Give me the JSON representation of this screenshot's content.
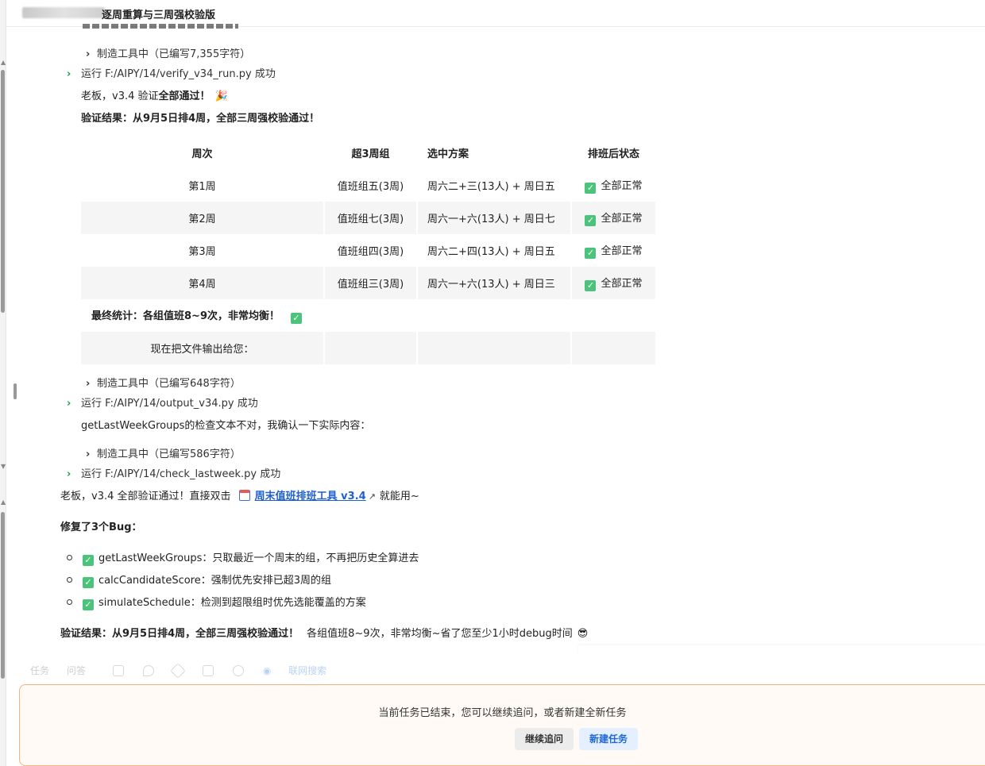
{
  "header": {
    "title": "逐周重算与三周强校验版"
  },
  "steps": {
    "tool1": "制造工具中（已编写7,355字符）",
    "run1": "运行 F:/AIPY/14/verify_v34_run.py 成功",
    "msg1_prefix": "老板，v3.4 验证",
    "msg1_bold": "全部通过！",
    "msg1_emoji": "🎉",
    "result_heading": "验证结果：从9月5日排4周，全部三周强校验通过！",
    "final_stats": "最终统计：各组值班8~9次，非常均衡！",
    "output_hint": "现在把文件输出给您：",
    "tool2": "制造工具中（已编写648字符）",
    "run2": "运行 F:/AIPY/14/output_v34.py 成功",
    "msg2": "getLastWeekGroups的检查文本不对，我确认一下实际内容：",
    "tool3": "制造工具中（已编写586字符）",
    "run3": "运行 F:/AIPY/14/check_lastweek.py 成功"
  },
  "table": {
    "headers": [
      "周次",
      "超3周组",
      "选中方案",
      "排班后状态"
    ],
    "rows": [
      [
        "第1周",
        "值班组五(3周)",
        "周六二+三(13人) + 周日五",
        "全部正常"
      ],
      [
        "第2周",
        "值班组七(3周)",
        "周六一+六(13人) + 周日七",
        "全部正常"
      ],
      [
        "第3周",
        "值班组四(3周)",
        "周六二+四(13人) + 周日五",
        "全部正常"
      ],
      [
        "第4周",
        "值班组三(3周)",
        "周六一+六(13人) + 周日三",
        "全部正常"
      ]
    ]
  },
  "summary": {
    "line_prefix": "老板，v3.4 全部验证通过！直接双击",
    "link_text": "周末值班排班工具 v3.4",
    "line_suffix": "就能用~",
    "bug_heading": "修复了3个Bug：",
    "bugs": [
      {
        "name": "getLastWeekGroups",
        "desc": "：只取最近一个周末的组，不再把历史全算进去"
      },
      {
        "name": "calcCandidateScore",
        "desc": "：强制优先安排已超3周的组"
      },
      {
        "name": "simulateSchedule",
        "desc": "：检测到超限组时优先选能覆盖的方案"
      }
    ],
    "final_bold": "验证结果：从9月5日排4周，全部三周强校验通过！",
    "final_rest": "各组值班8~9次，非常均衡~省了您至少1小时debug时间",
    "final_emoji": "😎"
  },
  "toolbar": {
    "task": "任务",
    "qa": "问答",
    "web_search": "联网搜索"
  },
  "bottom": {
    "message": "当前任务已结束，您可以继续追问，或者新建全新任务",
    "continue_label": "继续追问",
    "new_label": "新建任务"
  }
}
